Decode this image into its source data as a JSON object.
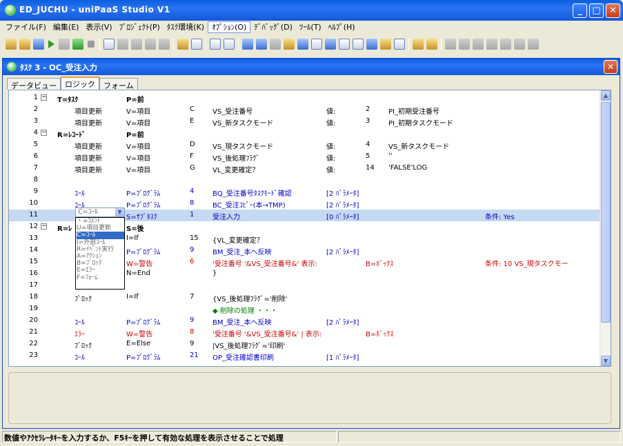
{
  "window": {
    "title": "ED_JUCHU - uniPaaS Studio V1",
    "buttons": [
      "_",
      "□",
      "✕"
    ]
  },
  "menu": [
    "ファイル(F)",
    "編集(E)",
    "表示(V)",
    "ﾌﾟﾛｼﾞｪｸﾄ(P)",
    "ﾀｽｸ環境(K)",
    "ｵﾌﾟｼｮﾝ(O)",
    "ﾃﾞﾊﾞｯｸﾞ(D)",
    "ﾂｰﾙ(T)",
    "ﾍﾙﾌﾟ(H)"
  ],
  "menu_active": "ｵﾌﾟｼｮﾝ(O)",
  "child_window": {
    "title": "ﾀｽｸ 3 -   OC_受注入力",
    "close": "✕"
  },
  "tabs": [
    "データビュー",
    "ロジック",
    "フォーム"
  ],
  "selected_tab": "ロジック",
  "logic_rows": [
    {
      "n": "1",
      "fold": "⊟",
      "c1": "T=ﾀｽｸ",
      "c2": "P=前",
      "c3": "",
      "c4": "",
      "c5": "",
      "c6": "",
      "c7": "",
      "head": true
    },
    {
      "n": "2",
      "fold": "",
      "c1": "項目更新",
      "c2": "V=項目",
      "c3": "C",
      "c4": "VS_受注番号",
      "c5": "値:",
      "c6": "2",
      "c7": "PI_初期受注番号"
    },
    {
      "n": "3",
      "fold": "",
      "c1": "項目更新",
      "c2": "V=項目",
      "c3": "E",
      "c4": "VS_新タスクモード",
      "c5": "値:",
      "c6": "3",
      "c7": "PI_初期タスクモード"
    },
    {
      "n": "4",
      "fold": "⊟",
      "c1": "R=ﾚｺｰﾄﾞ",
      "c2": "P=前",
      "c3": "",
      "c4": "",
      "c5": "",
      "c6": "",
      "c7": "",
      "head": true
    },
    {
      "n": "5",
      "fold": "",
      "c1": "項目更新",
      "c2": "V=項目",
      "c3": "D",
      "c4": "VS_現タスクモード",
      "c5": "値:",
      "c6": "4",
      "c7": "VS_新タスクモード"
    },
    {
      "n": "6",
      "fold": "",
      "c1": "項目更新",
      "c2": "V=項目",
      "c3": "F",
      "c4": "VS_後処理ﾌﾗｸﾞ",
      "c5": "値:",
      "c6": "5",
      "c7": "''"
    },
    {
      "n": "7",
      "fold": "",
      "c1": "項目更新",
      "c2": "V=項目",
      "c3": "G",
      "c4": "VL_変更確定？",
      "c5": "値:",
      "c6": "14",
      "c7": "'FALSE'LOG"
    },
    {
      "n": "8",
      "fold": "",
      "c1": "",
      "c2": "",
      "c3": "",
      "c4": "",
      "c5": "",
      "c6": "",
      "c7": ""
    },
    {
      "n": "9",
      "fold": "",
      "c1": "ｺｰﾙ",
      "c2": "P=ﾌﾟﾛｸﾞﾗﾑ",
      "c3": "4",
      "c4": "  BQ_受注番号ﾀｽｸﾓｰﾄﾞ確認",
      "c5": "[2 ﾊﾟﾗﾒｰﾀ]",
      "c6": "",
      "c7": "",
      "color": "blue"
    },
    {
      "n": "10",
      "fold": "",
      "c1": "ｺｰﾙ",
      "c2": "P=ﾌﾟﾛｸﾞﾗﾑ",
      "c3": "8",
      "c4": "BC_受注ｺﾋﾟｰ(本→TMP)",
      "c5": "[2 ﾊﾟﾗﾒｰﾀ]",
      "c6": "",
      "c7": "",
      "color": "blue"
    },
    {
      "n": "11",
      "fold": "",
      "c1": "",
      "c2": "S=ｻﾌﾞﾀｽｸ",
      "c3": "1",
      "c4": "受注入力",
      "c5": "[0 ﾊﾟﾗﾒｰﾀ]",
      "c6": "",
      "c7": "",
      "cond": "条件:  Yes",
      "color": "blue",
      "hl": true
    },
    {
      "n": "12",
      "fold": "⊟",
      "c1": "R=ﾚ",
      "c2": "S=後",
      "c3": "",
      "c4": "",
      "c5": "",
      "c6": "",
      "c7": "",
      "head": true
    },
    {
      "n": "13",
      "fold": "",
      "c1": "",
      "c2": "I=If",
      "c3": "15",
      "c4": "    {VL_変更確定？",
      "c5": "",
      "c6": "",
      "c7": ""
    },
    {
      "n": "14",
      "fold": "",
      "c1": "",
      "c2": "P=ﾌﾟﾛｸﾞﾗﾑ",
      "c3": "9",
      "c4": "BM_受注_本へ反映",
      "c5": "[2 ﾊﾟﾗﾒｰﾀ]",
      "c6": "",
      "c7": "",
      "color": "blue"
    },
    {
      "n": "15",
      "fold": "",
      "c1": "",
      "c2": "W=警告",
      "c3": "6",
      "c4": "'受注番号 '&VS_受注番号&' 表示:",
      "c5": "",
      "c6": "B=ﾎﾞｯｸｽ",
      "c7": "",
      "cond": "条件:  10    VS_現タスクモー",
      "color": "red"
    },
    {
      "n": "16",
      "fold": "",
      "c1": "",
      "c2": "N=End",
      "c3": "",
      "c4": "      }",
      "c5": "",
      "c6": "",
      "c7": ""
    },
    {
      "n": "17",
      "fold": "",
      "c1": "",
      "c2": "",
      "c3": "",
      "c4": "",
      "c5": "",
      "c6": "",
      "c7": ""
    },
    {
      "n": "18",
      "fold": "",
      "c1": "ﾌﾞﾛｯｸ",
      "c2": "I=If",
      "c3": "7",
      "c4": "    {VS_後処理ﾌﾗｸﾞ='削除'",
      "c5": "",
      "c6": "",
      "c7": ""
    },
    {
      "n": "19",
      "fold": "",
      "c1": "",
      "c2": "",
      "c3": "",
      "c4": "◆ 削除の処理 ・・・",
      "c5": "",
      "c6": "",
      "c7": "",
      "color": "green"
    },
    {
      "n": "20",
      "fold": "",
      "c1": "ｺｰﾙ",
      "c2": "P=ﾌﾟﾛｸﾞﾗﾑ",
      "c3": "9",
      "c4": "BM_受注_本へ反映",
      "c5": "[2 ﾊﾟﾗﾒｰﾀ]",
      "c6": "",
      "c7": "",
      "color": "blue"
    },
    {
      "n": "21",
      "fold": "",
      "c1": "ｴﾗｰ",
      "c2": "W=警告",
      "c3": "8",
      "c4": "'受注番号 '&VS_受注番号&' | 表示:",
      "c5": "",
      "c6": "B=ﾎﾞｯｸｽ",
      "c7": "",
      "color": "red"
    },
    {
      "n": "22",
      "fold": "",
      "c1": "ﾌﾞﾛｯｸ",
      "c2": "E=Else",
      "c3": "9",
      "c4": "  |VS_後処理ﾌﾗｸﾞ='印刷'",
      "c5": "",
      "c6": "",
      "c7": ""
    },
    {
      "n": "23",
      "fold": "",
      "c1": "ｺｰﾙ",
      "c2": "P=ﾌﾟﾛｸﾞﾗﾑ",
      "c3": "21",
      "c4": "OP_受注確認書印刷",
      "c5": "[1 ﾊﾟﾗﾒｰﾀ]",
      "c6": "",
      "c7": "",
      "color": "blue"
    }
  ],
  "combo": {
    "value": "C=ｺｰﾙ"
  },
  "dropdown_options": [
    "・=ｺﾒﾝﾄ",
    "U=項目更新",
    "C=ｺｰﾙ",
    "I=外部ｺｰﾙ",
    "R=ｲﾍﾞﾝﾄ実行",
    "A=ｱｸｼｮﾝ",
    "B=ﾌﾞﾛｯｸ",
    "E=ｴﾗｰ",
    "F=ﾌｫｰﾑ"
  ],
  "dropdown_selected": "C=ｺｰﾙ",
  "status": {
    "message": "数値やｱｸｾﾗﾚｰﾀｷｰを入力するか、F5ｷｰを押して有効な処理を表示させることで処理"
  },
  "colors": {
    "title_blue": "#0a5fe0",
    "highlight": "#c6d9f2",
    "keyword_blue": "#0000c8",
    "warn_red": "#d00000",
    "comment_green": "#008000"
  },
  "icons": [
    "new-icon",
    "open-icon",
    "open-folder-icon",
    "run-icon",
    "build-icon",
    "check-in-icon",
    "stop-icon",
    "zoom-icon",
    "pause-icon",
    "step-icon",
    "step-out-icon",
    "step-over-icon",
    "tree-icon",
    "layout-icon",
    "find-icon",
    "list-icon",
    "program-icon",
    "form-icon",
    "model-icon",
    "table-icon",
    "report-icon",
    "data-icon",
    "help-icon",
    "rights-icon",
    "menu-icon",
    "properties-icon",
    "edit-icon",
    "generate-icon",
    "users-icon",
    "wand-icon"
  ]
}
